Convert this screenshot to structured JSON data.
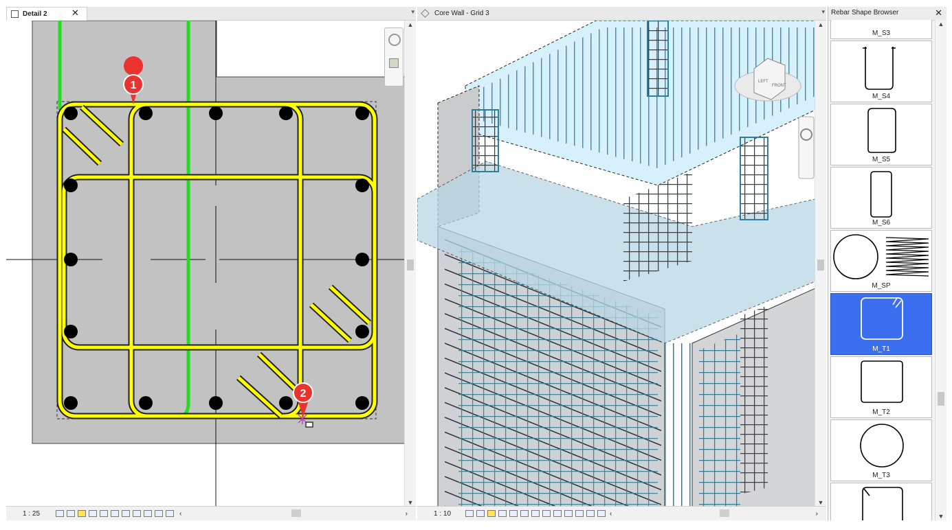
{
  "left_view": {
    "tab_title": "Detail 2",
    "close_glyph": "✕",
    "dropdown_glyph": "▾",
    "scale": "1 : 25",
    "callouts": [
      "1",
      "2"
    ],
    "icons": [
      "view-detail-icon",
      "nav-wheel-icon",
      "zoom-region-icon"
    ]
  },
  "right_view": {
    "tab_title": "Core Wall - Grid 3",
    "dropdown_glyph": "▾",
    "scale": "1 : 10",
    "viewcube_labels": [
      "LEFT",
      "FRONT"
    ]
  },
  "browser": {
    "title": "Rebar Shape Browser",
    "close_glyph": "✕",
    "shapes": [
      {
        "name": "M_S3",
        "selected": false
      },
      {
        "name": "M_S4",
        "selected": false
      },
      {
        "name": "M_S5",
        "selected": false
      },
      {
        "name": "M_S6",
        "selected": false
      },
      {
        "name": "M_SP",
        "selected": false
      },
      {
        "name": "M_T1",
        "selected": true
      },
      {
        "name": "M_T2",
        "selected": false
      },
      {
        "name": "M_T3",
        "selected": false
      },
      {
        "name": "",
        "selected": false
      }
    ]
  },
  "colors": {
    "stirrup": "#ffff00",
    "green_bar": "#22dd22",
    "concrete": "#c2c2c2",
    "rebar_teal": "#2e7d9a",
    "selection": "#3c6ef0",
    "callout": "#e8332e"
  }
}
